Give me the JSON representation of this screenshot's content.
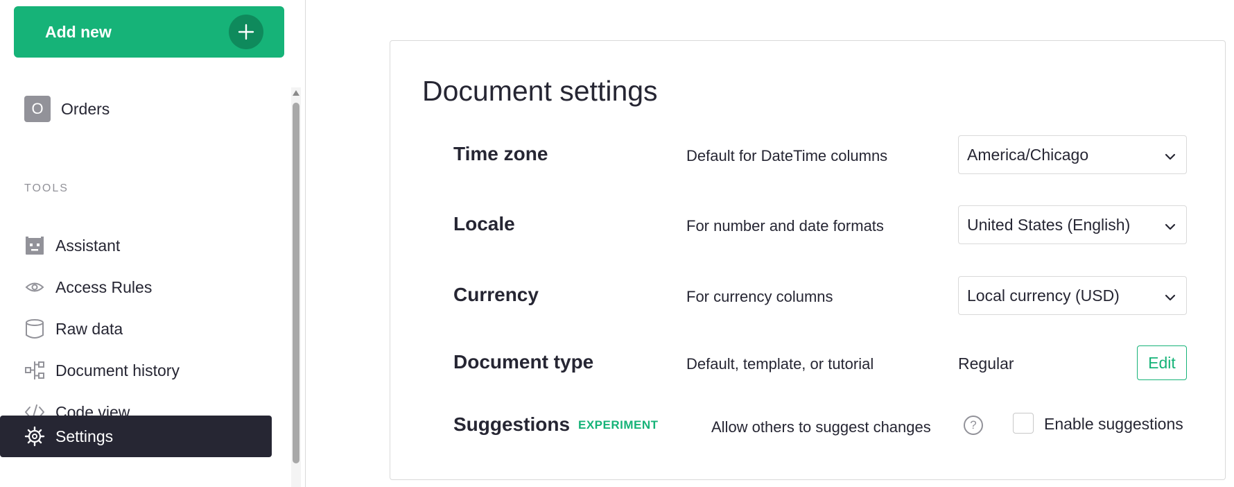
{
  "sidebar": {
    "add_new_label": "Add new",
    "page": {
      "initial": "O",
      "label": "Orders"
    },
    "tools_header": "TOOLS",
    "tools": [
      {
        "label": "Assistant",
        "icon": "robot-icon"
      },
      {
        "label": "Access Rules",
        "icon": "eye-icon"
      },
      {
        "label": "Raw data",
        "icon": "database-icon"
      },
      {
        "label": "Document history",
        "icon": "history-icon"
      },
      {
        "label": "Code view",
        "icon": "code-icon"
      },
      {
        "label": "Settings",
        "icon": "gear-icon",
        "active": true
      }
    ]
  },
  "settings": {
    "title": "Document settings",
    "time_zone": {
      "label": "Time zone",
      "description": "Default for DateTime columns",
      "value": "America/Chicago"
    },
    "locale": {
      "label": "Locale",
      "description": "For number and date formats",
      "value": "United States (English)"
    },
    "currency": {
      "label": "Currency",
      "description": "For currency columns",
      "value": "Local currency (USD)"
    },
    "document_type": {
      "label": "Document type",
      "description": "Default, template, or tutorial",
      "value": "Regular",
      "edit_label": "Edit"
    },
    "suggestions": {
      "label": "Suggestions",
      "badge": "EXPERIMENT",
      "description": "Allow others to suggest changes",
      "help_glyph": "?",
      "checkbox_label": "Enable suggestions",
      "checked": false
    }
  },
  "colors": {
    "accent": "#16b378",
    "accent_dark": "#0f8a5c",
    "text": "#262633",
    "muted": "#929299",
    "active_bg": "#262633",
    "border": "#d9d9d9"
  }
}
